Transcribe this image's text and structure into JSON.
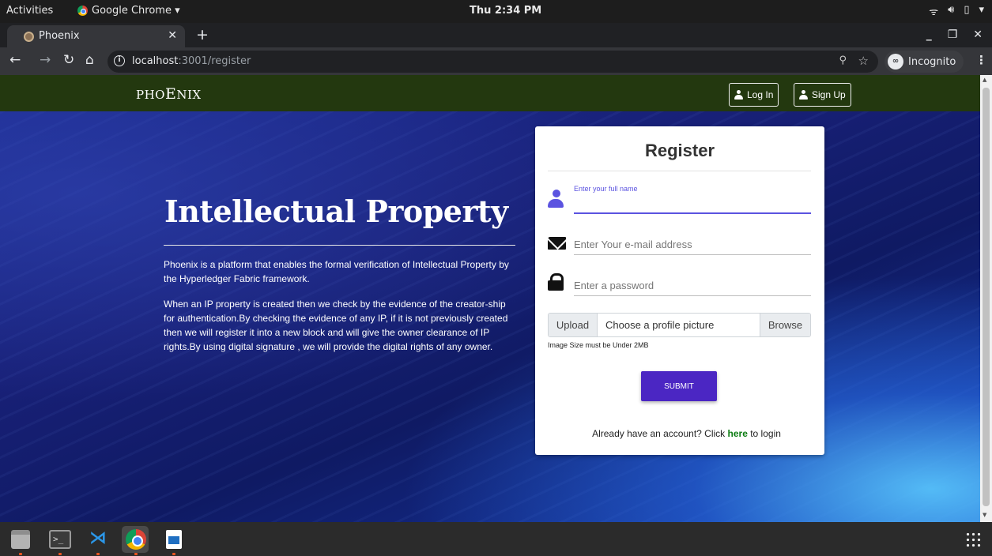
{
  "system": {
    "activities": "Activities",
    "app_menu": "Google Chrome ▾",
    "clock": "Thu  2:34 PM",
    "tray": [
      "wifi-icon",
      "volume-icon",
      "battery-icon",
      "power-menu-icon"
    ]
  },
  "browser": {
    "tab_title": "Phoenix",
    "url_host": "localhost",
    "url_path": ":3001/register",
    "profile_label": "Incognito"
  },
  "navbar": {
    "brand_prefix": "PHO",
    "brand_big": "E",
    "brand_suffix": "NIX",
    "login_label": "Log In",
    "signup_label": "Sign Up"
  },
  "hero": {
    "title": "Intellectual Property",
    "paragraph1": "Phoenix is a platform that enables the formal verification of Intellectual Property by the Hyperledger Fabric framework.",
    "paragraph2": "When an IP property is created then we check by the evidence of the creator-ship for authentication.By checking the evidence of any IP, if it is not previously created then we will register it into a new block and will give the owner clearance of IP rights.By using digital signature , we will provide the digital rights of any owner."
  },
  "form": {
    "title": "Register",
    "name_label": "Enter your full name",
    "name_value": "",
    "email_placeholder": "Enter Your e-mail address",
    "password_placeholder": "Enter a password",
    "upload_label": "Upload",
    "file_label": "Choose a profile picture",
    "browse_label": "Browse",
    "size_hint": "Image Size must be Under 2MB",
    "submit_label": "SUBMIT",
    "login_prompt": "Already have an account? Click ",
    "login_link": "here",
    "login_suffix": " to login"
  },
  "colors": {
    "navbar_bg": "#23380f",
    "accent": "#5b53e0",
    "submit_bg": "#4b26c3",
    "link": "#0c7c12"
  },
  "dock": [
    "files-icon",
    "terminal-icon",
    "vscode-icon",
    "chrome-icon",
    "writer-icon",
    "app-grid-icon"
  ]
}
